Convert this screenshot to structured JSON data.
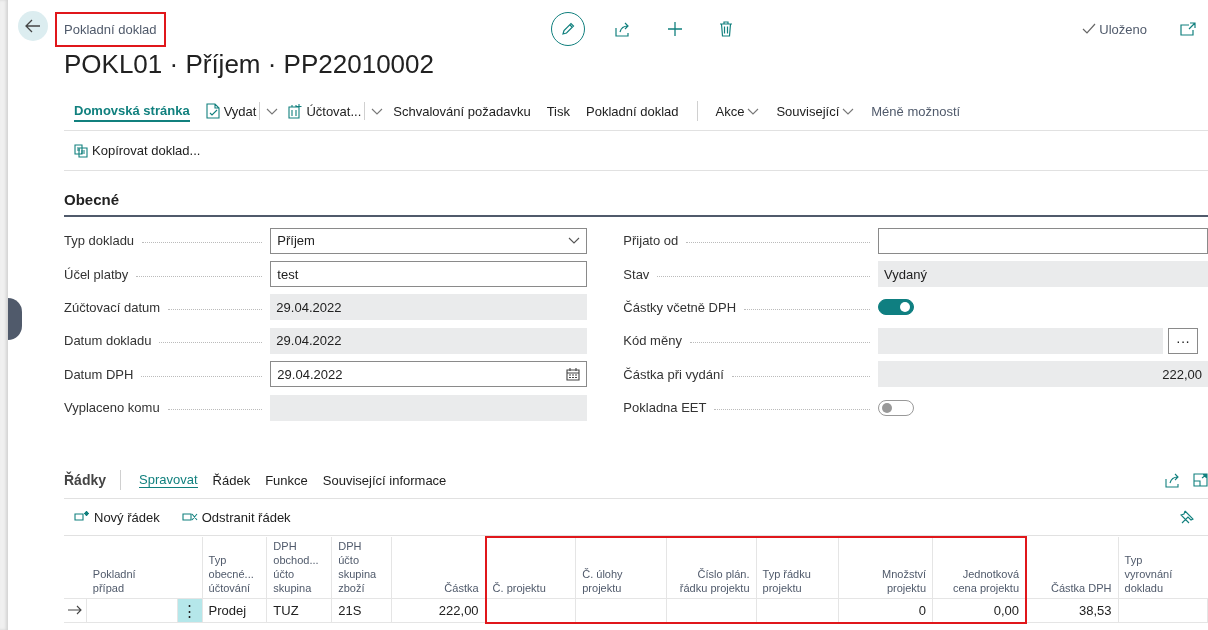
{
  "header": {
    "breadcrumb": "Pokladní doklad",
    "breadcrumb_highlighted": true,
    "title": "POKL01 · Příjem · PP22010002",
    "saved": "Uloženo"
  },
  "action_bar": [
    {
      "label": "Domovská stránka",
      "kind": "tab",
      "selected": true
    },
    {
      "label": "Vydat",
      "kind": "split",
      "selected": false
    },
    {
      "label": "Účtovat...",
      "kind": "split",
      "selected": false
    },
    {
      "label": "Schvalování požadavku",
      "kind": "plain",
      "selected": false
    },
    {
      "label": "Tisk",
      "kind": "plain",
      "selected": false
    },
    {
      "label": "Pokladní doklad",
      "kind": "plain",
      "selected": false
    },
    {
      "label": "Akce",
      "kind": "menu",
      "selected": false
    },
    {
      "label": "Související",
      "kind": "menu",
      "selected": false
    },
    {
      "label": "Méně možností",
      "kind": "muted",
      "selected": false
    }
  ],
  "secondary_actions": [
    "Kopírovat doklad..."
  ],
  "general": {
    "title": "Obecné",
    "left": [
      {
        "label": "Typ dokladu",
        "kind": "select",
        "value": "Příjem"
      },
      {
        "label": "Účel platby",
        "kind": "text",
        "value": "test"
      },
      {
        "label": "Zúčtovací datum",
        "kind": "readonly",
        "value": "29.04.2022"
      },
      {
        "label": "Datum dokladu",
        "kind": "readonly",
        "value": "29.04.2022"
      },
      {
        "label": "Datum DPH",
        "kind": "date",
        "value": "29.04.2022"
      },
      {
        "label": "Vyplaceno komu",
        "kind": "readonly"
      }
    ],
    "right": [
      {
        "label": "Přijato od",
        "kind": "text"
      },
      {
        "label": "Stav",
        "kind": "readonly",
        "value": "Vydaný"
      },
      {
        "label": "Částky včetně DPH",
        "kind": "toggle",
        "on": true
      },
      {
        "label": "Kód měny",
        "kind": "lookup",
        "button": "···"
      },
      {
        "label": "Částka při vydání",
        "kind": "amount",
        "value": "222,00"
      },
      {
        "label": "Pokladna EET",
        "kind": "toggle",
        "on": false
      }
    ]
  },
  "lines": {
    "title": "Řádky",
    "tabs": [
      {
        "label": "Spravovat",
        "selected": true
      },
      {
        "label": "Řádek",
        "selected": false
      },
      {
        "label": "Funkce",
        "selected": false
      },
      {
        "label": "Související informace",
        "selected": false
      }
    ],
    "actions": [
      {
        "label": "Nový řádek",
        "kind": "new"
      },
      {
        "label": "Odstranit řádek",
        "kind": "delete"
      }
    ],
    "columns": [
      {
        "label": "Pokladní\npřípad",
        "kind": "text",
        "highlighted": false
      },
      {
        "label": "Typ\nobecné...\núčtování",
        "kind": "text",
        "highlighted": false
      },
      {
        "label": "DPH\nobchod...\núčto\nskupina",
        "kind": "text",
        "highlighted": false
      },
      {
        "label": "DPH\núčto\nskupina\nzboží",
        "kind": "text",
        "highlighted": false
      },
      {
        "label": "Částka",
        "kind": "number",
        "highlighted": false
      },
      {
        "label": "Č. projektu",
        "kind": "text",
        "highlighted": true
      },
      {
        "label": "Č. úlohy\nprojektu",
        "kind": "text",
        "highlighted": true
      },
      {
        "label": "Číslo plán.\nřádku projektu",
        "kind": "number",
        "highlighted": true
      },
      {
        "label": "Typ řádku\nprojektu",
        "kind": "text",
        "highlighted": true
      },
      {
        "label": "Množství\nprojektu",
        "kind": "number",
        "highlighted": true
      },
      {
        "label": "Jednotková\ncena projektu",
        "kind": "number",
        "highlighted": true
      },
      {
        "label": "Částka DPH",
        "kind": "number",
        "highlighted": false
      },
      {
        "label": "Typ\nvyrovnání\ndokladu",
        "kind": "text",
        "highlighted": false
      }
    ],
    "rows": [
      {
        "current": true,
        "menu": "⋮",
        "cells": [
          null,
          "Prodej",
          "TUZ",
          "21S",
          "222,00",
          null,
          null,
          null,
          null,
          "0",
          "0,00",
          "38,53",
          null
        ]
      }
    ]
  }
}
